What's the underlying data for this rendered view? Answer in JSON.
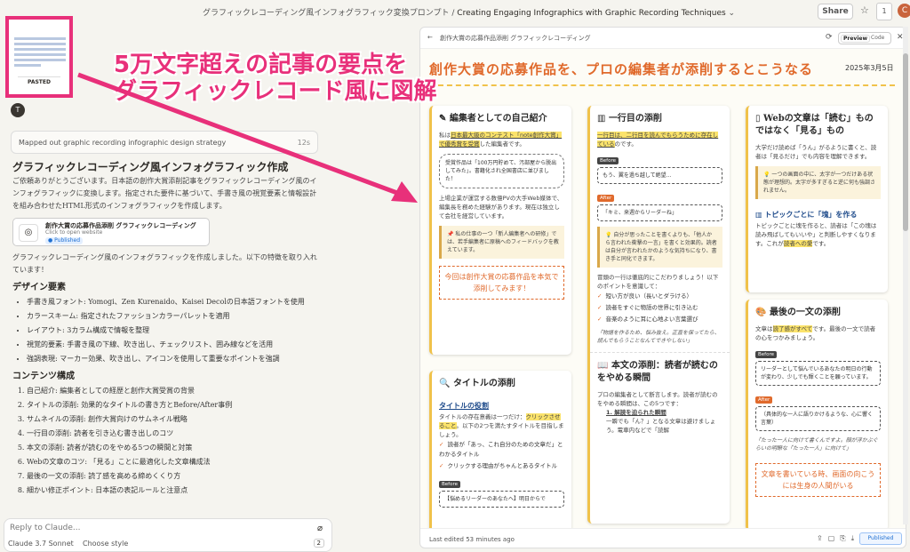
{
  "topbar": {
    "breadcrumb_project": "グラフィックレコーディング風インフォグラフィック変換プロンプト",
    "breadcrumb_sep": "/",
    "breadcrumb_chat": "Creating Engaging Infographics with Graphic Recording Techniques",
    "share": "Share",
    "star": "☆",
    "notif": "1",
    "avatar": "C"
  },
  "thumbnail": {
    "label": "PASTED"
  },
  "overlay": {
    "line1": "5万文字超えの記事の要点を",
    "line2": "グラフィックレコード風に図解"
  },
  "chat": {
    "user_initial": "T",
    "thinking": "Mapped out graphic recording infographic design strategy",
    "thinking_time": "12s",
    "h1": "グラフィックレコーディング風インフォグラフィック作成",
    "intro": "ご依頼ありがとうございます。日本語の創作大賞添削記事をグラフィックレコーディング風のインフォグラフィックに変換します。指定された要件に基づいて、手書き風の視覚要素と情報設計を組み合わせたHTML形式のインフォグラフィックを作成します。",
    "card_title": "創作大賞の応募作品添削 グラフィックレコーディング",
    "card_sub": "Click to open website",
    "card_badge": "● Published",
    "after": "グラフィックレコーディング風のインフォグラフィックを作成しました。以下の特徴を取り入れています！",
    "design_h": "デザイン要素",
    "design": [
      "手書き風フォント: Yomogi、Zen Kurenaido、Kaisei Decolの日本語フォントを使用",
      "カラースキーム: 指定されたファッションカラーパレットを適用",
      "レイアウト: 3カラム構成で情報を整理",
      "視覚的要素: 手書き風の下線、吹き出し、チェックリスト、囲み線などを活用",
      "強調表現: マーカー効果、吹き出し、アイコンを使用して重要なポイントを強調"
    ],
    "content_h": "コンテンツ構成",
    "content": [
      "自己紹介: 編集者としての経歴と創作大賞受賞の背景",
      "タイトルの添削: 効果的なタイトルの書き方とBefore/After事例",
      "サムネイルの添削: 創作大賞向けのサムネイル戦略",
      "一行目の添削: 読者を引き込む書き出しのコツ",
      "本文の添削: 読者が読むのをやめる5つの瞬間と対策",
      "Webの文章のコツ: 「見る」ことに最適化した文章構成法",
      "最後の一文の添削: 読了感を高める締めくくり方",
      "細かい修正ポイント: 日本語の表記ルールと注意点"
    ]
  },
  "reply": {
    "placeholder": "Reply to Claude...",
    "model": "Claude 3.7 Sonnet",
    "style": "Choose style",
    "count": "2"
  },
  "panel": {
    "title": "創作大賞の応募作品添削 グラフィックレコーディング",
    "preview": "Preview",
    "code": "Code",
    "footer": "Last edited 53 minutes ago",
    "published": "Published",
    "main_title": "創作大賞の応募作品を、プロの編集者が添削するとこうなる",
    "date": "2025年3月5日",
    "c1": {
      "title": "編集者としての自己紹介",
      "p1a": "私は",
      "p1b": "日本最大級のコンテスト「note創作大賞」で優秀賞を受賞",
      "p1c": "した編集者です。",
      "bubble": "受賞作品は「100万円貯めて、汚部屋から脱出してみた」。書籍化され全国書店に並びました！",
      "p2": "上場企業が運営する数億PVの大手Web媒体で、編集長を務めた経験があります。現在は独立して会社を経営しています。",
      "quote": "私の仕事の一つ「新人編集者への研修」では、若手編集者に原稿へのフィードバックを教えています。",
      "red": "今回は創作大賞の応募作品を本気で添削してみます！",
      "t2": "タイトルの添削",
      "s2": "タイトルの役割",
      "p3a": "タイトルの存在意義は一つだけ：",
      "p3b": "クリックさせること",
      "p3c": "。以下の2つを満たすタイトルを目指しましょう。",
      "k1": "読者が「あっ、これ自分のための文章だ」とわかるタイトル",
      "k2": "クリックする理由がちゃんとあるタイトル",
      "before": "Before",
      "b2": "【悩めるリーダーのあなたへ】明日からで"
    },
    "c2": {
      "title": "一行目の添削",
      "p1": "一行目は、二行目を読んでもらうために存在している",
      "p1b": "のです。",
      "before": "Before",
      "b1": "もう、翼を過ち越して絶望…",
      "after": "After",
      "a1": "「キミ、来週からリーダーね」",
      "quote": "自分が思ったことを書くよりも、「他人から言われた衝撃の一言」を書くと効果的。読者は自分が言われたかのような気持ちになり、書き手と同化できます。",
      "p2": "冒頭の一行は徹底的にこだわりましょう！以下のポイントを意識して：",
      "k1": "短い方が良い（長いとダラける）",
      "k2": "読者をすぐに物語の世界に引き込む",
      "k3": "音楽のように耳に心地よい言葉選び",
      "ital": "「物語を作るため、悩み抜え。正直を保ってたら、読んでもらうことなんてできやしない」",
      "t2": "本文の添削：読者が読むのをやめる瞬間",
      "p3": "プロの編集者として断言します。読者が読むのをやめる瞬間は、この5つです：",
      "n1": "1. 解読を迫られた瞬間",
      "n1b": "一瞬でも「ん？」となる文章は避けましょう。電車内などで「読解"
    },
    "c3": {
      "title": "Webの文章は「読む」ものではなく「見る」もの",
      "p1": "大学だけ読めば「うん」がるように書くと、読者は「見るだけ」でも内容を理解できます。",
      "quote": "一つの画面の中に、太字が一つだけある状態が理想的。太字が多すぎると逆に何も強調されません。",
      "s1": "トピックごとに「塊」を作る",
      "p2a": "トピックごとに塊を作ると、読者は「この塊は読み飛ばしてもいいや」と判断しやすくなります。これが",
      "p2b": "読者への愛",
      "p2c": "です。",
      "t2": "最後の一文の添削",
      "p3a": "文章は",
      "p3b": "読了感がすべて",
      "p3c": "です。最後の一文で読者の心をつかみましょう。",
      "before": "Before",
      "b1": "リーダーとして悩んでいるあなたの明日の行動が変わり、少しでも輝くことを願っています。",
      "after": "After",
      "a1": "（具体的な一人に語りかけるような、心に響く言葉）",
      "ital": "「たった一人に向けて書くんですよ。顔が浮かぶぐらいの明瞭な「たった一人」に向けて」",
      "red": "文章を書いている時、画面の向こうには生身の人間がいる"
    }
  }
}
